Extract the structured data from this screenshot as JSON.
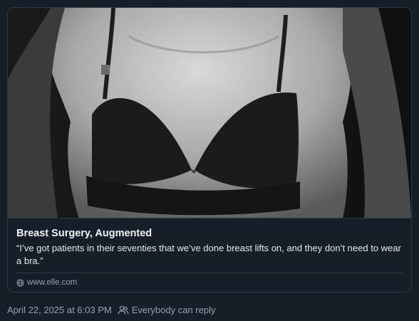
{
  "embed": {
    "image_alt": "Black and white photo of a torso wearing a black bra",
    "title": "Breast Surgery, Augmented",
    "description": "“I’ve got patients in their seventies that we’ve done breast lifts on, and they don’t need to wear a bra.”",
    "domain": "www.elle.com",
    "domain_icon": "globe-icon"
  },
  "post_meta": {
    "timestamp": "April 22, 2025 at 6:03 PM",
    "reply_setting": "Everybody can reply",
    "reply_icon": "people-icon"
  },
  "colors": {
    "background": "#161e27",
    "border": "#2e3a48",
    "title": "#f1f3f5",
    "muted": "#93a1b1"
  }
}
